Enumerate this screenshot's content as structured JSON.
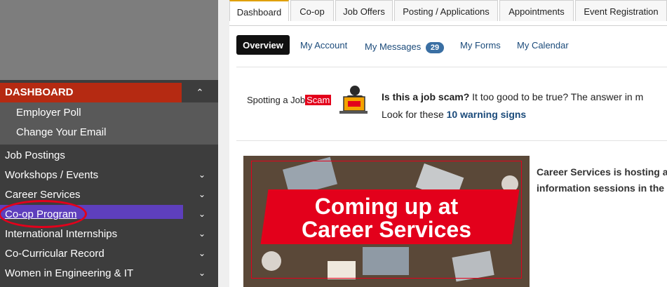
{
  "sidebar": {
    "section": {
      "label": "DASHBOARD"
    },
    "sub_items": [
      {
        "label": "Employer Poll"
      },
      {
        "label": "Change Your Email"
      }
    ],
    "items": [
      {
        "label": "Job Postings",
        "has_chevron": false
      },
      {
        "label": "Workshops / Events",
        "has_chevron": true
      },
      {
        "label": "Career Services",
        "has_chevron": true
      },
      {
        "label": "Co-op Program",
        "has_chevron": true,
        "active": true
      },
      {
        "label": "International Internships",
        "has_chevron": true
      },
      {
        "label": "Co-Curricular Record",
        "has_chevron": true
      },
      {
        "label": "Women in Engineering & IT",
        "has_chevron": true
      }
    ]
  },
  "tabs": [
    {
      "label": "Dashboard",
      "active": true
    },
    {
      "label": "Co-op"
    },
    {
      "label": "Job Offers"
    },
    {
      "label": "Posting / Applications"
    },
    {
      "label": "Appointments"
    },
    {
      "label": "Event Registration"
    }
  ],
  "subnav": {
    "overview": "Overview",
    "my_account": "My Account",
    "my_messages": "My Messages",
    "messages_count": "29",
    "my_forms": "My Forms",
    "my_calendar": "My Calendar"
  },
  "scam": {
    "logo_text": "Spotting a Job",
    "logo_highlight": "Scam",
    "question": "Is this a job scam?",
    "question_rest": " It too good to be true? The answer in m",
    "look_for": "Look for these ",
    "warning_link": "10 warning signs"
  },
  "banner": {
    "line1": "Coming up at",
    "line2": "Career Services"
  },
  "career_services": {
    "line1": "Career Services is hosting a",
    "line2": "information sessions in the"
  },
  "colors": {
    "accent_red": "#b52a12",
    "active_purple": "#5e3fbd",
    "link_blue": "#1a4a7a",
    "badge_blue": "#3a6fa3"
  }
}
